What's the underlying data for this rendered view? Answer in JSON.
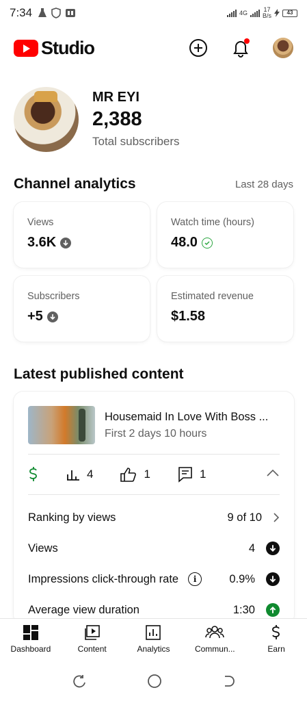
{
  "status_bar": {
    "time": "7:34",
    "network_a": "4G",
    "speed_value": "17",
    "speed_unit": "B/s",
    "battery": "43"
  },
  "header": {
    "app_name": "Studio"
  },
  "channel": {
    "name": "MR EYI",
    "subscribers": "2,388",
    "subscribers_label": "Total subscribers"
  },
  "analytics": {
    "title": "Channel analytics",
    "period": "Last 28 days",
    "cards": [
      {
        "label": "Views",
        "value": "3.6K",
        "trend": "down"
      },
      {
        "label": "Watch time (hours)",
        "value": "48.0",
        "trend": "check"
      },
      {
        "label": "Subscribers",
        "value": "+5",
        "trend": "down"
      },
      {
        "label": "Estimated revenue",
        "value": "$1.58",
        "trend": "none"
      }
    ]
  },
  "latest": {
    "title": "Latest published content",
    "video_title": "Housemaid In Love With Boss ...",
    "video_subtitle": "First 2 days 10 hours",
    "stats": {
      "views": "4",
      "likes": "1",
      "comments": "1"
    },
    "metrics": [
      {
        "label": "Ranking by views",
        "value": "9 of 10",
        "indicator": "chevron"
      },
      {
        "label": "Views",
        "value": "4",
        "indicator": "down"
      },
      {
        "label": "Impressions click-through rate",
        "value": "0.9%",
        "indicator": "down"
      },
      {
        "label": "Average view duration",
        "value": "1:30",
        "indicator": "up"
      }
    ]
  },
  "bottom_nav": [
    {
      "label": "Dashboard",
      "icon": "dashboard-icon"
    },
    {
      "label": "Content",
      "icon": "content-icon"
    },
    {
      "label": "Analytics",
      "icon": "analytics-icon"
    },
    {
      "label": "Commun...",
      "icon": "community-icon"
    },
    {
      "label": "Earn",
      "icon": "earn-icon"
    }
  ],
  "colors": {
    "brand_red": "#ff0000",
    "accent_green": "#0f8a2f",
    "text_secondary": "#606060"
  }
}
